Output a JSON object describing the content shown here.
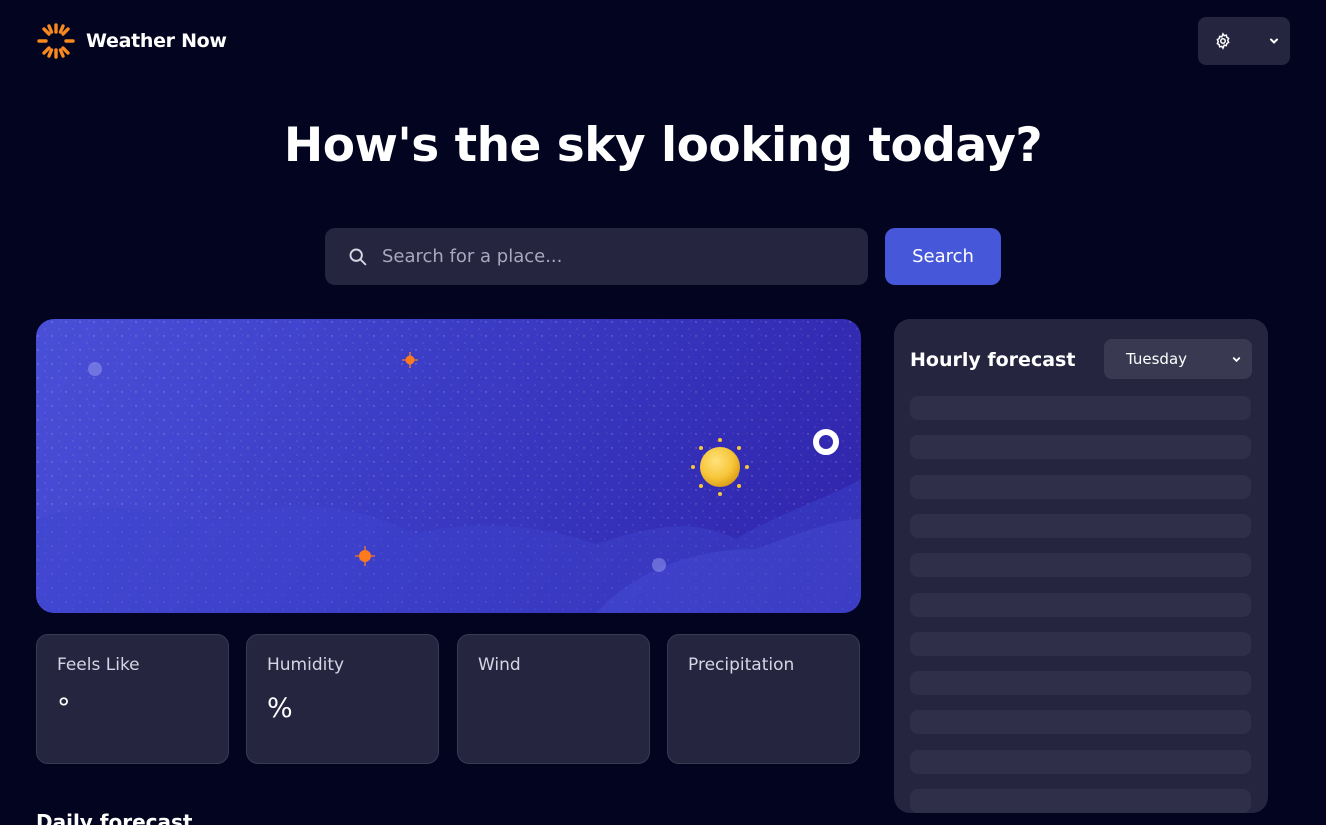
{
  "app": {
    "name": "Weather Now",
    "brand_color": "#f7891f"
  },
  "header": {
    "units_icon": "gear-icon",
    "units_chevron": "chevron-down-icon"
  },
  "hero": {
    "title": "How's the sky looking today?"
  },
  "search": {
    "placeholder": "Search for a place...",
    "button_label": "Search",
    "icon": "search-icon",
    "button_color": "#4658d9"
  },
  "current": {
    "card_icon": "sun-icon"
  },
  "stats": [
    {
      "label": "Feels Like",
      "value": "°"
    },
    {
      "label": "Humidity",
      "value": "%"
    },
    {
      "label": "Wind",
      "value": ""
    },
    {
      "label": "Precipitation",
      "value": ""
    }
  ],
  "daily": {
    "title": "Daily forecast"
  },
  "hourly": {
    "title": "Hourly forecast",
    "selected_day": "Tuesday",
    "placeholder_rows": 11
  }
}
